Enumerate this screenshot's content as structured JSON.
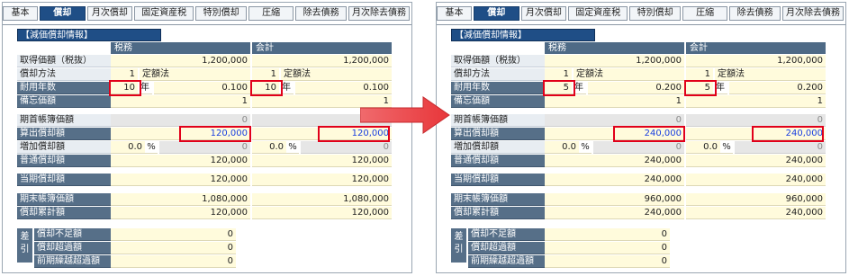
{
  "tabs": [
    "基本",
    "償却",
    "月次償却",
    "固定資産税",
    "特別償却",
    "圧縮",
    "除去債務",
    "月次除去債務"
  ],
  "active_tab": "償却",
  "section_title": "【減価償却情報】",
  "columns": {
    "tax": "税務",
    "accounting": "会計"
  },
  "labels": {
    "acq": "取得価額（税抜）",
    "method": "償却方法",
    "life": "耐用年数",
    "memo": "備忘価額",
    "begin": "期首帳簿価額",
    "calc": "算出償却額",
    "add": "増加償却額",
    "normal": "普通償却額",
    "current": "当期償却額",
    "end": "期末帳簿価額",
    "accum": "償却累計額",
    "sa": "差引",
    "short": "償却不足額",
    "over": "償却超過額",
    "prev": "前期繰越超過額"
  },
  "units": {
    "year": "年",
    "percent": "%"
  },
  "before": {
    "tax": {
      "acq": "1,200,000",
      "method_no": "1",
      "method_name": "定額法",
      "life": "10",
      "rate": "0.100",
      "memo": "1",
      "begin": "0",
      "calc": "120,000",
      "add_pct": "0.0",
      "add": "0",
      "normal": "120,000",
      "current": "120,000",
      "end": "1,080,000",
      "accum": "120,000"
    },
    "acc": {
      "acq": "1,200,000",
      "method_no": "1",
      "method_name": "定額法",
      "life": "10",
      "rate": "0.100",
      "memo": "1",
      "begin": "0",
      "calc": "120,000",
      "add_pct": "0.0",
      "add": "0",
      "normal": "120,000",
      "current": "120,000",
      "end": "1,080,000",
      "accum": "120,000"
    },
    "sa": {
      "short": "0",
      "over": "0",
      "prev": "0"
    }
  },
  "after": {
    "tax": {
      "acq": "1,200,000",
      "method_no": "1",
      "method_name": "定額法",
      "life": "5",
      "rate": "0.200",
      "memo": "1",
      "begin": "0",
      "calc": "240,000",
      "add_pct": "0.0",
      "add": "0",
      "normal": "240,000",
      "current": "240,000",
      "end": "960,000",
      "accum": "240,000"
    },
    "acc": {
      "acq": "1,200,000",
      "method_no": "1",
      "method_name": "定額法",
      "life": "5",
      "rate": "0.200",
      "memo": "1",
      "begin": "0",
      "calc": "240,000",
      "add_pct": "0.0",
      "add": "0",
      "normal": "240,000",
      "current": "240,000",
      "end": "960,000",
      "accum": "240,000"
    },
    "sa": {
      "short": "0",
      "over": "0",
      "prev": "0"
    }
  },
  "colors": {
    "tab_active": "#1f4e86",
    "highlight": "#e1001a",
    "input_bg": "#fffbdc",
    "arrow": "#e8363a"
  }
}
